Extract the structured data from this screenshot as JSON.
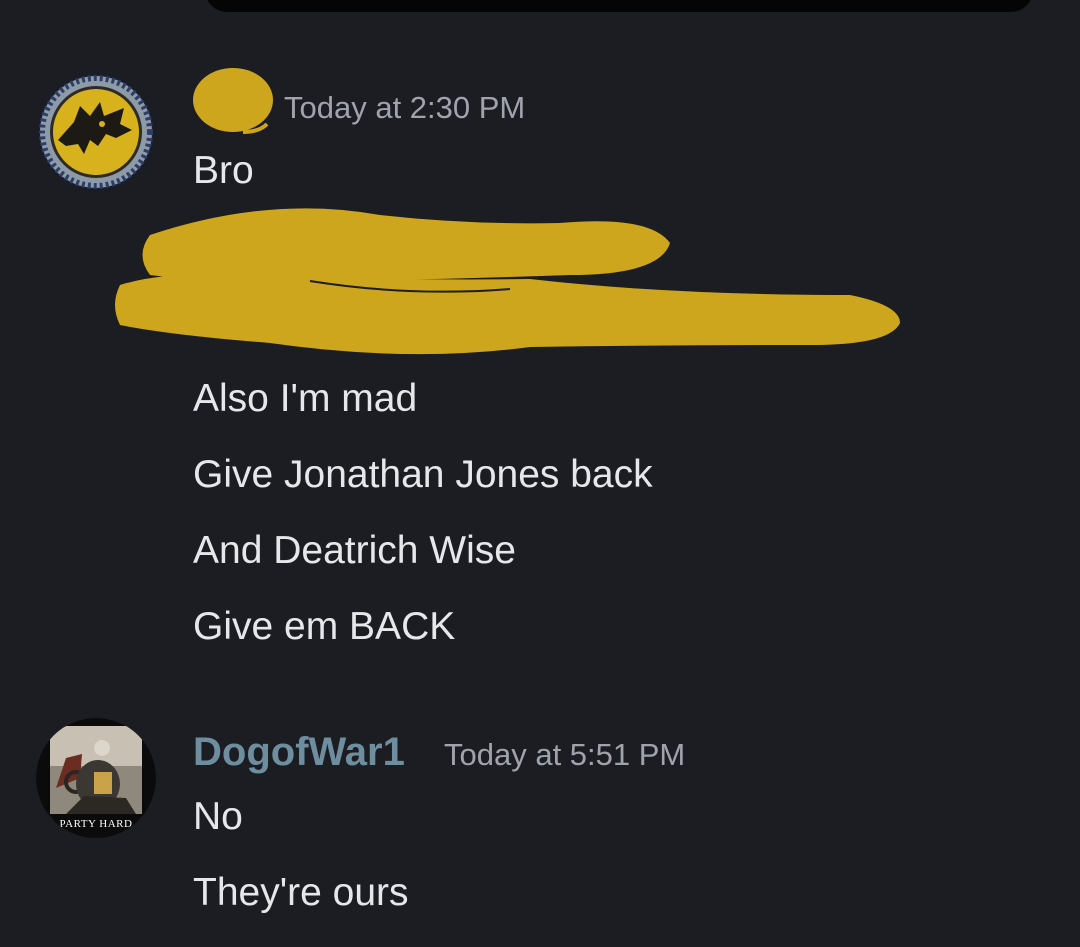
{
  "colors": {
    "background": "#1c1d22",
    "message_text": "#e6e7ea",
    "timestamp": "#9fa3ab",
    "username_dogofwar": "#6e8ea0",
    "redaction_marker": "#cea61d"
  },
  "messages": [
    {
      "avatar_icon": "wolf-emblem-avatar",
      "username": "",
      "timestamp": "Today at 2:30 PM",
      "lines": [
        "Bro",
        "Also I'm mad",
        "Give Jonathan Jones back",
        "And Deatrich Wise",
        "Give em BACK"
      ]
    },
    {
      "avatar_icon": "party-hard-avatar",
      "avatar_caption": "PARTY HARD",
      "username": "DogofWar1",
      "timestamp": "Today at 5:51 PM",
      "lines": [
        "No",
        "They're ours"
      ]
    }
  ]
}
